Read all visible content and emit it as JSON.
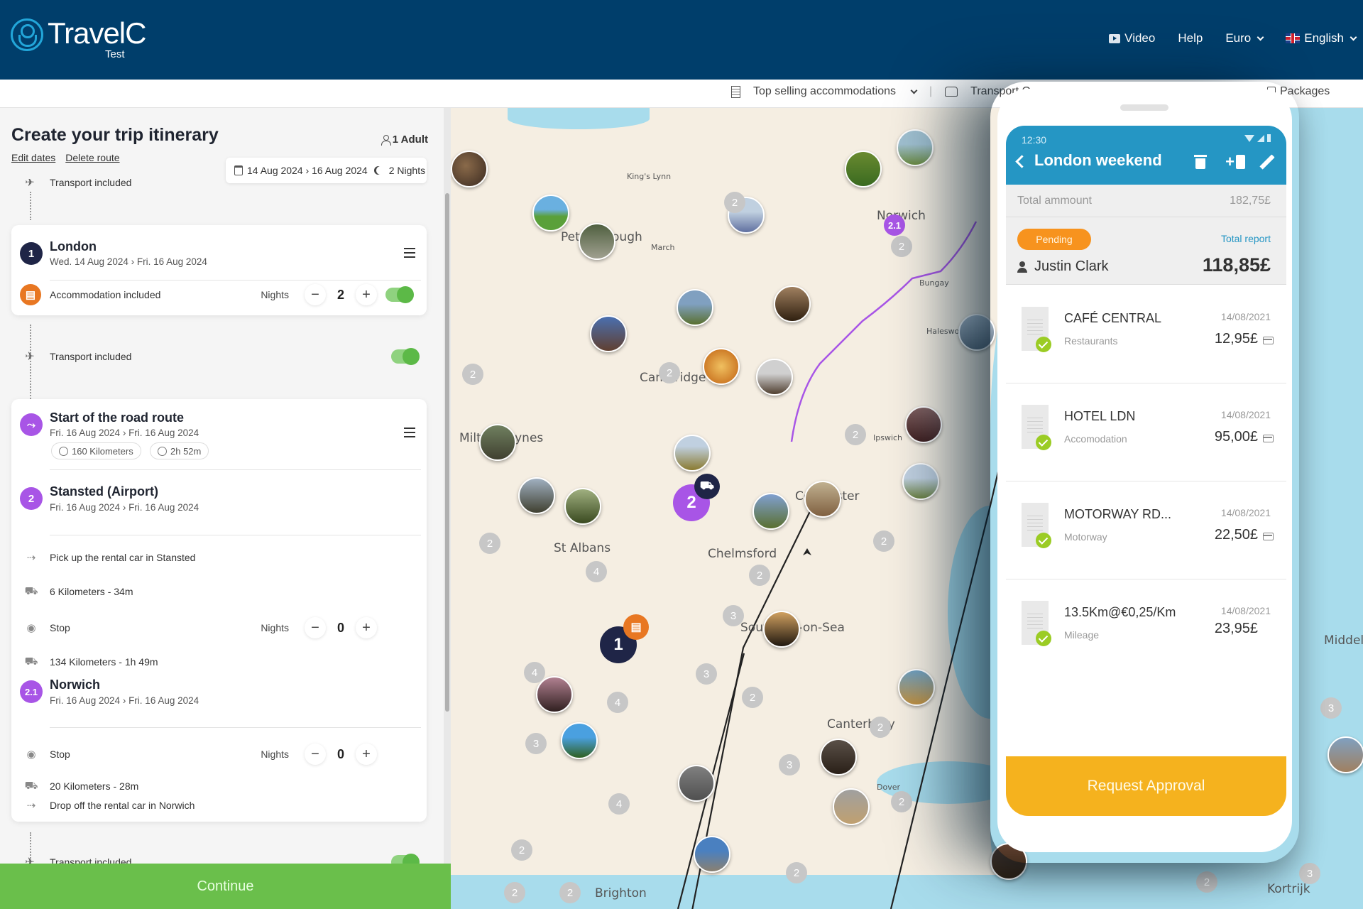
{
  "header": {
    "brand": "TravelC",
    "brand_sub": "Test",
    "nav": {
      "video": "Video",
      "help": "Help",
      "currency": "Euro",
      "language": "English"
    }
  },
  "subnav": {
    "accommodations": "Top selling accommodations",
    "transport": "Transport O",
    "packages": "Packages"
  },
  "itinerary": {
    "title": "Create your trip itinerary",
    "edit_dates": "Edit dates",
    "delete_route": "Delete route",
    "travellers": "1 Adult",
    "date_range": "14 Aug 2024 › 16 Aug 2024",
    "nights_summary": "2 Nights",
    "transport_top": "Transport included",
    "london": {
      "badge": "1",
      "title": "London",
      "dates": "Wed. 14 Aug 2024 › Fri. 16 Aug 2024",
      "accommodation": "Accommodation included",
      "nights_label": "Nights",
      "nights": "2"
    },
    "transport_mid": "Transport included",
    "road_route": {
      "title": "Start of the road route",
      "dates": "Fri. 16 Aug 2024 › Fri. 16 Aug 2024",
      "distance": "160 Kilometers",
      "duration": "2h 52m"
    },
    "stansted": {
      "badge": "2",
      "title": "Stansted (Airport)",
      "dates": "Fri. 16 Aug 2024 › Fri. 16 Aug 2024",
      "pickup": "Pick up the rental car in Stansted",
      "leg1": "6 Kilometers - 34m",
      "stop": "Stop",
      "nights_label": "Nights",
      "nights": "0",
      "leg2": "134 Kilometers - 1h 49m"
    },
    "norwich": {
      "badge": "2.1",
      "title": "Norwich",
      "dates": "Fri. 16 Aug 2024 › Fri. 16 Aug 2024",
      "stop": "Stop",
      "nights_label": "Nights",
      "nights": "0",
      "leg": "20 Kilometers - 28m",
      "dropoff": "Drop off the rental car in Norwich"
    },
    "transport_bottom": "Transport included",
    "continue": "Continue"
  },
  "map": {
    "cities": [
      "Peterborough",
      "King's Lynn",
      "March",
      "Norwich",
      "Cambridge",
      "Milton Keynes",
      "St Albans",
      "Chelmsford",
      "Colchester",
      "Ipswich",
      "Southend-on-Sea",
      "Canterbury",
      "Brighton",
      "Dover",
      "Middelburg",
      "Kortrijk",
      "Bungay",
      "Halesworth"
    ],
    "pins": {
      "london": "1",
      "stansted": "2",
      "norwich": "2.1"
    },
    "colors": {
      "route_purple": "#a855e6",
      "london_pin": "#1f2547",
      "hotel_pin": "#e87722"
    }
  },
  "phone": {
    "status_time": "12:30",
    "title": "London weekend",
    "total_label": "Total ammount",
    "total_value": "182,75£",
    "status": "Pending",
    "total_report_label": "Total report",
    "user": "Justin Clark",
    "user_total": "118,85£",
    "expenses": [
      {
        "name": "CAFÉ CENTRAL",
        "category": "Restaurants",
        "date": "14/08/2021",
        "amount": "12,95£",
        "card": true
      },
      {
        "name": "HOTEL LDN",
        "category": "Accomodation",
        "date": "14/08/2021",
        "amount": "95,00£",
        "card": true
      },
      {
        "name": "MOTORWAY RD...",
        "category": "Motorway",
        "date": "14/08/2021",
        "amount": "22,50£",
        "card": true
      },
      {
        "name": "13.5Km@€0,25/Km",
        "category": "Mileage",
        "date": "14/08/2021",
        "amount": "23,95£",
        "card": false
      }
    ],
    "request_approval": "Request Approval",
    "colors": {
      "app_bar": "#2596c4",
      "pending": "#f7931e",
      "approve": "#f5b21e",
      "check": "#9bcc24"
    }
  }
}
